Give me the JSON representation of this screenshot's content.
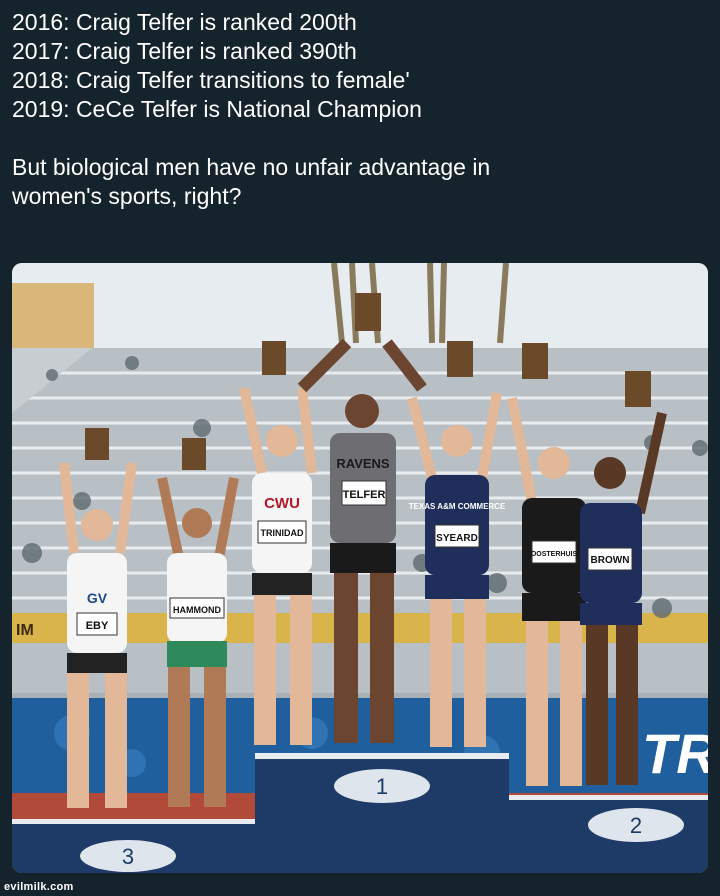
{
  "caption": {
    "lines": [
      "2016: Craig Telfer is ranked 200th",
      "2017: Craig Telfer is ranked 390th",
      "2018: Craig Telfer transitions to female'",
      "2019: CeCe Telfer is National Champion"
    ],
    "question_line1": "But biological men have no unfair advantage in",
    "question_line2": "women's sports, right?"
  },
  "photo": {
    "podium_places": [
      "1",
      "2",
      "3"
    ],
    "bibs": [
      "EBY",
      "HAMMOND",
      "TRINIDAD",
      "TELFER",
      "SYEARD",
      "OOSTERHUIS",
      "BROWN"
    ],
    "jersey_text": [
      "CWU",
      "RAVENS",
      "TEXAS A&M COMMERCE",
      "GV"
    ],
    "banner_text": "TR",
    "banner_left_text": "IM",
    "colors": {
      "caption_bg": "#15232d",
      "podium_blue": "#1d3b66",
      "banner_blue": "#1f5f9e"
    }
  },
  "watermark": "evilmilk.com"
}
